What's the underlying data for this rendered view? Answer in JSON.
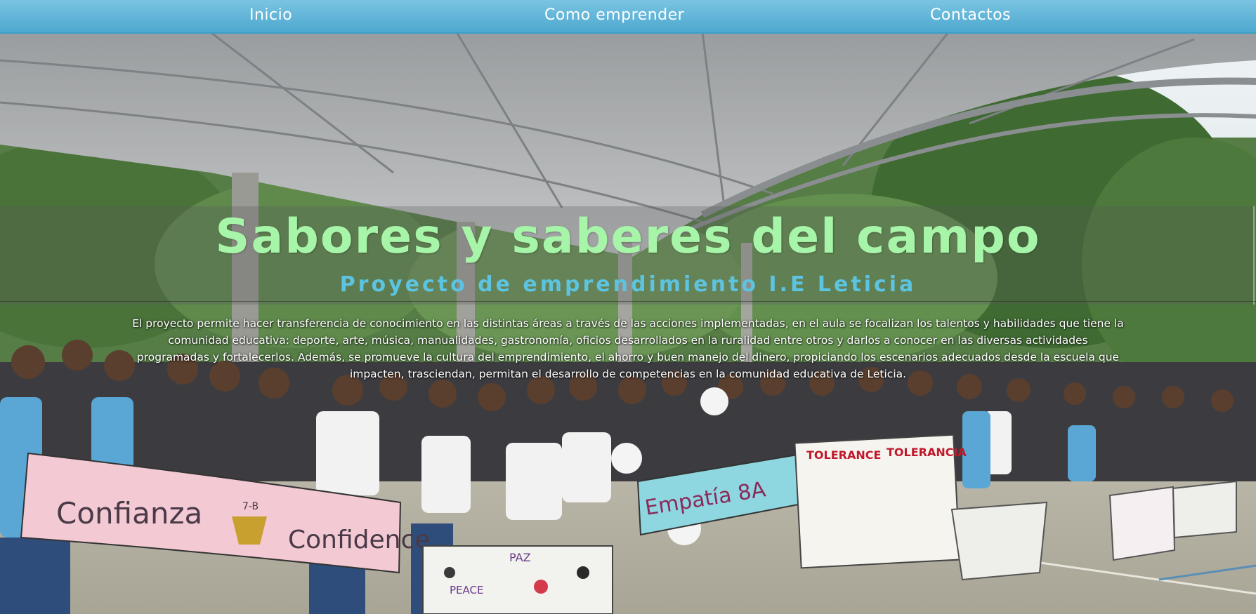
{
  "nav": {
    "items": [
      {
        "label": "Inicio"
      },
      {
        "label": "Como emprender"
      },
      {
        "label": "Contactos"
      }
    ]
  },
  "hero": {
    "title": "Sabores y saberes del campo",
    "subtitle": "Proyecto de emprendimiento I.E Leticia",
    "description": "El proyecto permite hacer transferencia de conocimiento en las distintas áreas a través de las acciones implementadas, en el aula se focalizan los talentos y habilidades que tiene la comunidad educativa: deporte, arte, música, manualidades, gastronomía, oficios desarrollados en la ruralidad entre otros y darlos a conocer en las diversas actividades programadas y fortalecerlos. Además, se promueve la cultura del emprendimiento, el ahorro y buen manejo del dinero, propiciando los escenarios adecuados desde la escuela que impacten, trasciendan, permitan el desarrollo de competencias en la comunidad educativa de Leticia.",
    "photo": {
      "banners": [
        {
          "text": "Confianza"
        },
        {
          "text": "Confidence"
        },
        {
          "text": "7-B"
        },
        {
          "text": "Empatía 8A"
        },
        {
          "text": "TOLERANCE"
        },
        {
          "text": "TOLERANCIA"
        },
        {
          "text": "PAZ"
        },
        {
          "text": "PEACE"
        }
      ]
    }
  },
  "colors": {
    "nav_bg": "#5db4d8",
    "title": "#a6f5a8",
    "subtitle": "#5cc3e0",
    "description": "#ffffff"
  }
}
